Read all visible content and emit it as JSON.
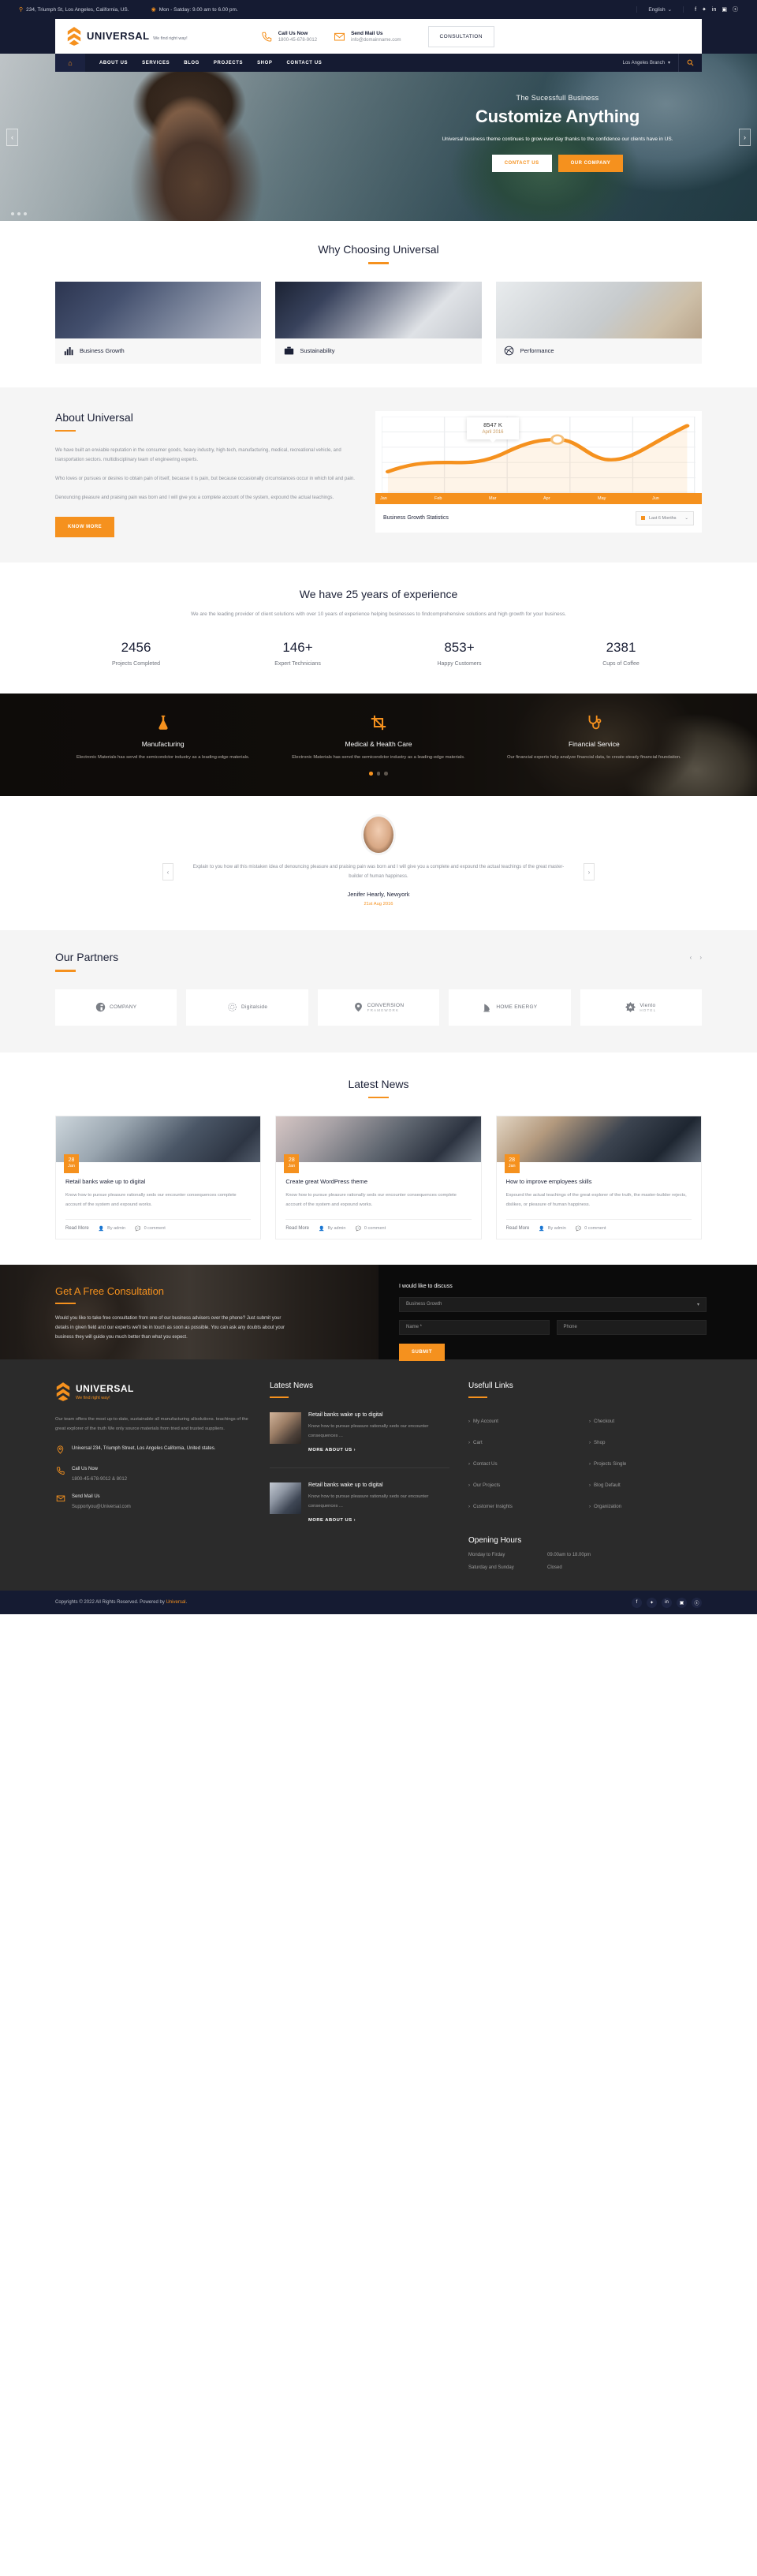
{
  "topbar": {
    "address": "234, Triumph St, Los Angeles, California, US.",
    "hours": "Mon - Satday: 9.00 am to 6.00 pm.",
    "language": "English",
    "socials": [
      "f",
      "t",
      "in",
      "v",
      "s"
    ]
  },
  "header": {
    "brand": "UNIVERSAL",
    "tagline": "We find right way!",
    "call_label": "Call Us Now",
    "call_value": "1800-45-678-9012",
    "mail_label": "Send Mail Us",
    "mail_value": "info@domainname.com",
    "consultation": "CONSULTATION"
  },
  "nav": {
    "items": [
      "ABOUT US",
      "SERVICES",
      "BLOG",
      "PROJECTS",
      "SHOP",
      "CONTACT US"
    ],
    "branch": "Los Angeles Branch"
  },
  "hero": {
    "subtitle": "The Sucessfull Business",
    "title": "Customize Anything",
    "description": "Universal business theme continues to grow ever day thanks to the confidence our clients have in US.",
    "btn_primary": "CONTACT US",
    "btn_secondary": "OUR COMPANY"
  },
  "why": {
    "heading": "Why Choosing Universal",
    "cards": [
      {
        "label": "Business Growth",
        "icon": "bar-chart-icon"
      },
      {
        "label": "Sustainability",
        "icon": "briefcase-icon"
      },
      {
        "label": "Performance",
        "icon": "dribbble-icon"
      }
    ]
  },
  "about": {
    "heading": "About Universal",
    "paragraphs": [
      "We have built an enviable reputation in the consumer goods, heavy industry, high-tech, manufacturing, medical, recreational vehicle, and transportation sectors. multidisciplinary team of engineering experts.",
      "Who loves or pursues or desires to obtain pain of itself, because it is pain, but because occasionally circumstances occur in which toil and pain.",
      "Denouncing pleasure and praising pain was born and I will give you a complete account of the system, expound the actual teachings."
    ],
    "button": "KNOW MORE",
    "chart_title": "Business Growth Statistics",
    "chart_filter": "Last 6 Months"
  },
  "chart_data": {
    "type": "line",
    "title": "Business Growth Statistics",
    "categories": [
      "Jan",
      "Feb",
      "Mar",
      "Apr",
      "May",
      "Jun"
    ],
    "values": [
      30,
      42,
      44,
      66,
      52,
      92
    ],
    "tooltip": {
      "value": "8547 K",
      "date": "April 2016",
      "point_index": 3
    },
    "xlabel": "",
    "ylabel": "",
    "ylim": [
      0,
      100
    ],
    "grid": true,
    "legend": "none",
    "series_color": "#f5911e"
  },
  "experience": {
    "heading": "We have 25 years of experience",
    "lead": "We are the leading provider of client solutions with over 10 years of experience helping businesses to findcomprehensive solutions and high growth for your business.",
    "counters": [
      {
        "number": "2456",
        "label": "Projects Completed"
      },
      {
        "number": "146+",
        "label": "Expert Technicians"
      },
      {
        "number": "853+",
        "label": "Happy Customers"
      },
      {
        "number": "2381",
        "label": "Cups of Coffee"
      }
    ]
  },
  "services": {
    "items": [
      {
        "icon": "flask-icon",
        "title": "Manufacturing",
        "text": "Electronic Materials has servd the semicondctor industry as a leading-edge materials."
      },
      {
        "icon": "crop-icon",
        "title": "Medical & Health Care",
        "text": "Electronic Materials has servd the semicondctor industry as a leading-edge materials."
      },
      {
        "icon": "stethoscope-icon",
        "title": "Financial Service",
        "text": "Our financial experts help analyze financial data, to create steady financial foundation."
      }
    ],
    "active_dot": 0,
    "dots": 3
  },
  "testimonial": {
    "quote": "Explain to you how all this mistaken idea of denouncing pleasure and praising pain was born and I will give you a complete and expound the actual teachings of the great master-builder of human happiness.",
    "name": "Jenifer Hearly, Newyork",
    "date": "21st Aug 2016"
  },
  "partners": {
    "heading": "Our Partners",
    "logos": [
      {
        "name": "COMPANY",
        "sub": ""
      },
      {
        "name": "Digitalside",
        "sub": ""
      },
      {
        "name": "CONVERSION",
        "sub": "FRAMEWORK"
      },
      {
        "name": "HOME ENERGY",
        "sub": ""
      },
      {
        "name": "Viento",
        "sub": "HOTEL"
      }
    ]
  },
  "news": {
    "heading": "Latest News",
    "posts": [
      {
        "day": "28",
        "month": "Jan",
        "title": "Retail banks wake up to digital",
        "excerpt": "Know how to pursue pleasure rationally seds our encounter consequences complete account of the system and expound works.",
        "read_more": "Read More",
        "author": "By admin",
        "comments": "0 comment"
      },
      {
        "day": "28",
        "month": "Jan",
        "title": "Create great WordPress theme",
        "excerpt": "Know how to pursue pleasure rationally seds our encounter consequences complete account of the system and expound works.",
        "read_more": "Read More",
        "author": "By admin",
        "comments": "0 comment"
      },
      {
        "day": "28",
        "month": "Jan",
        "title": "How to improve employees skills",
        "excerpt": "Expound the actual teachings of the great explorer of the truth, the master-builder rejects, dislikes, or pleasure of human happiness.",
        "read_more": "Read More",
        "author": "By admin",
        "comments": "0 comment"
      }
    ]
  },
  "consultation": {
    "heading": "Get A Free Consultation",
    "text": "Would you like to take free consultation from one of our business advisers over the phone? Just submit your details in given field and our experts we'll be in touch as soon as possible. You can ask any doubts about your business they will guide you much better than what you expect.",
    "form_title": "I would like to discuss",
    "select_value": "Business Growth",
    "name_placeholder": "Name *",
    "phone_placeholder": "Phone",
    "submit": "SUBMIT"
  },
  "footer": {
    "brand": "UNIVERSAL",
    "tagline": "We find right way!",
    "desc": "Our team offers the most up-to-date, sustainable all manufacturing allsolutions. teachings of the great explorer of the truth We only source materials from tried and trusted suppliers.",
    "address": "Universal 234, Triumph Street, Los Angeles California, United states.",
    "call_label": "Call Us Now",
    "call_value": "1800-45-678-9012 & 8012",
    "mail_label": "Send Mail Us",
    "mail_value": "Supportyou@Universal.com",
    "news_heading": "Latest News",
    "news": [
      {
        "title": "Retail banks wake up to digital",
        "text": "Know how to pursue pleasure rationally seds our encounter consequences ...",
        "more": "MORE ABOUT US"
      },
      {
        "title": "Retail banks wake up to digital",
        "text": "Know how to pursue pleasure rationally seds our encounter consequences ...",
        "more": "MORE ABOUT US"
      }
    ],
    "links_heading": "Usefull Links",
    "links_col1": [
      "My Account",
      "Cart",
      "Contact Us",
      "Our Projects",
      "Customer Insights"
    ],
    "links_col2": [
      "Checkout",
      "Shop",
      "Projects Single",
      "Blog Default",
      "Organization"
    ],
    "hours_heading": "Opening Hours",
    "hours": [
      {
        "days": "Monday to Firday",
        "time": "09.00am to 18.00pm"
      },
      {
        "days": "Saturday and Sunday",
        "time": "Closed"
      }
    ],
    "copyright_pre": "Copyrights © 2022 All Rights Reserved. Powered by ",
    "copyright_brand": "Universal",
    "socials": [
      "f",
      "t",
      "in",
      "v",
      "s"
    ]
  },
  "colors": {
    "accent": "#f5911e",
    "dark": "#151b32",
    "footer": "#2b2b2b"
  }
}
